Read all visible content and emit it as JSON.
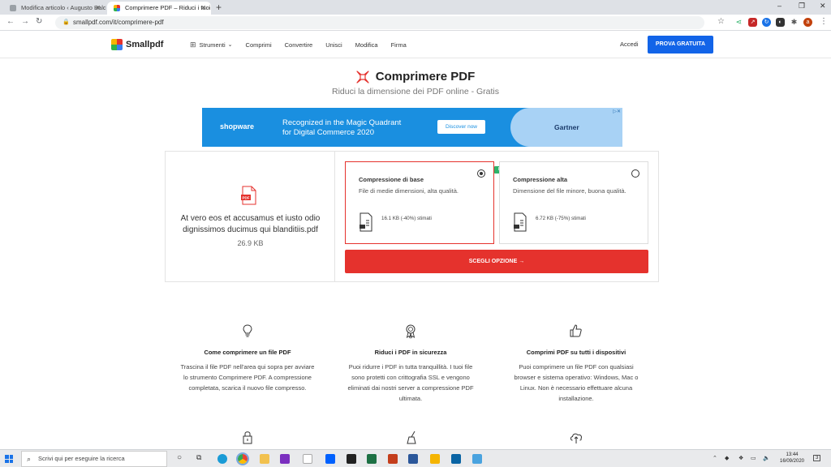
{
  "browser": {
    "tabs": [
      {
        "title": "Modifica articolo ‹ Augusto Baldi..."
      },
      {
        "title": "Comprimere PDF – Riduci i tuoi f..."
      }
    ],
    "new_tab": "+",
    "url": "smallpdf.com/it/comprimere-pdf",
    "window_controls": [
      "–",
      "❐",
      "✕"
    ],
    "profile_initial": "a"
  },
  "site": {
    "logo_text": "Smallpdf",
    "nav": {
      "tools": "Strumenti",
      "items": [
        "Comprimi",
        "Convertire",
        "Unisci",
        "Modifica",
        "Firma"
      ]
    },
    "login": "Accedi",
    "cta": "PROVA GRATUITA"
  },
  "hero": {
    "title": "Comprimere PDF",
    "subtitle": "Riduci la dimensione dei PDF online - Gratis"
  },
  "ad": {
    "brand": "shopware",
    "line1": "Recognized in the Magic Quadrant",
    "line2": "for Digital Commerce 2020",
    "button": "Discover now",
    "partner": "Gartner",
    "close": "▷✕"
  },
  "file": {
    "icon_label": "PDF",
    "name": "At vero eos et accusamus et iusto odio dignissimos ducimus qui blanditiis.pdf",
    "size": "26.9 KB"
  },
  "options": [
    {
      "title": "Compressione di base",
      "desc": "File di medie dimensioni, alta qualità.",
      "estimate": "16.1 KB (-40%) stimati",
      "selected": true
    },
    {
      "title": "Compressione alta",
      "desc": "Dimensione del file minore, buona qualità.",
      "estimate": "6.72 KB (-75%) stimati",
      "selected": false,
      "badge": "PRO"
    }
  ],
  "choose_button": "SCEGLI OPZIONE →",
  "features": [
    {
      "title": "Come comprimere un file PDF",
      "text": "Trascina il file PDF nell'area qui sopra per avviare lo strumento Comprimere PDF. A compressione completata, scarica il nuovo file compresso."
    },
    {
      "title": "Riduci i PDF in sicurezza",
      "text": "Puoi ridurre i PDF in tutta tranquillità. I tuoi file sono protetti con crittografia SSL e vengono eliminati dai nostri server a compressione PDF ultimata."
    },
    {
      "title": "Comprimi PDF su tutti i dispositivi",
      "text": "Puoi comprimere un file PDF con qualsiasi browser e sistema operativo: Windows, Mac o Linux. Non è necessario effettuare alcuna installazione."
    }
  ],
  "taskbar": {
    "search_placeholder": "Scrivi qui per eseguire la ricerca",
    "time": "13:44",
    "date": "16/09/2020",
    "notifications": "3"
  },
  "colors": {
    "accent_red": "#e5322d",
    "primary_blue": "#1264e8",
    "pro_green": "#2fb36b"
  }
}
